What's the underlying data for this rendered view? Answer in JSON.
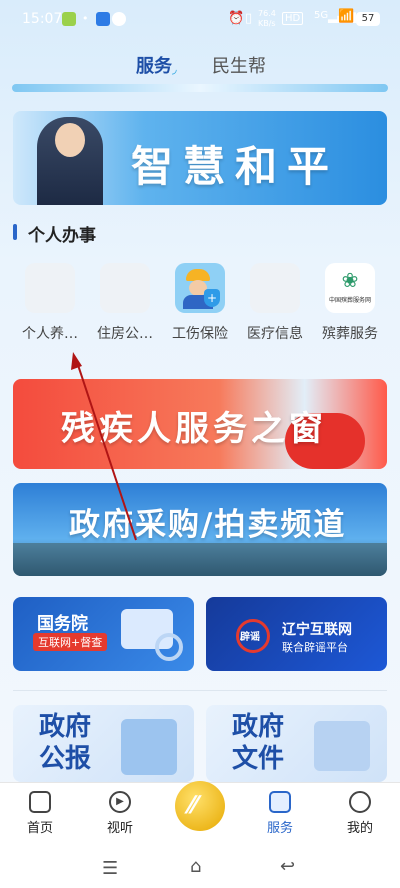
{
  "status_bar": {
    "time": "15:07",
    "speed": "76.4\nKB/s",
    "network": "5G",
    "battery": "57"
  },
  "top_tabs": [
    {
      "label": "服务",
      "active": true
    },
    {
      "label": "民生帮",
      "active": false
    }
  ],
  "banners": {
    "hero": "智慧和平",
    "disabled": "残疾人服务之窗",
    "procurement": "政府采购/拍卖频道",
    "guowuyuan_title": "国务院",
    "guowuyuan_sub": "互联网+督查",
    "rumor_title": "辽宁互联网",
    "rumor_sub": "联合辟谣平台",
    "rumor_badge": "辟谣",
    "gazette": "政府\n公报",
    "documents": "政府\n文件"
  },
  "section_title": "个人办事",
  "services": [
    {
      "label": "个人养…"
    },
    {
      "label": "住房公…"
    },
    {
      "label": "工伤保险"
    },
    {
      "label": "医疗信息"
    },
    {
      "label": "殡葬服务",
      "logo_text": "中国殡葬服务网"
    }
  ],
  "bottom_nav": [
    {
      "label": "首页",
      "icon": "home-icon"
    },
    {
      "label": "视听",
      "icon": "play-icon"
    },
    {
      "label": "",
      "icon": "center-logo"
    },
    {
      "label": "服务",
      "icon": "service-icon",
      "active": true
    },
    {
      "label": "我的",
      "icon": "profile-icon"
    }
  ],
  "colors": {
    "accent": "#1e4fa7",
    "nav_active": "#2a66c9"
  }
}
